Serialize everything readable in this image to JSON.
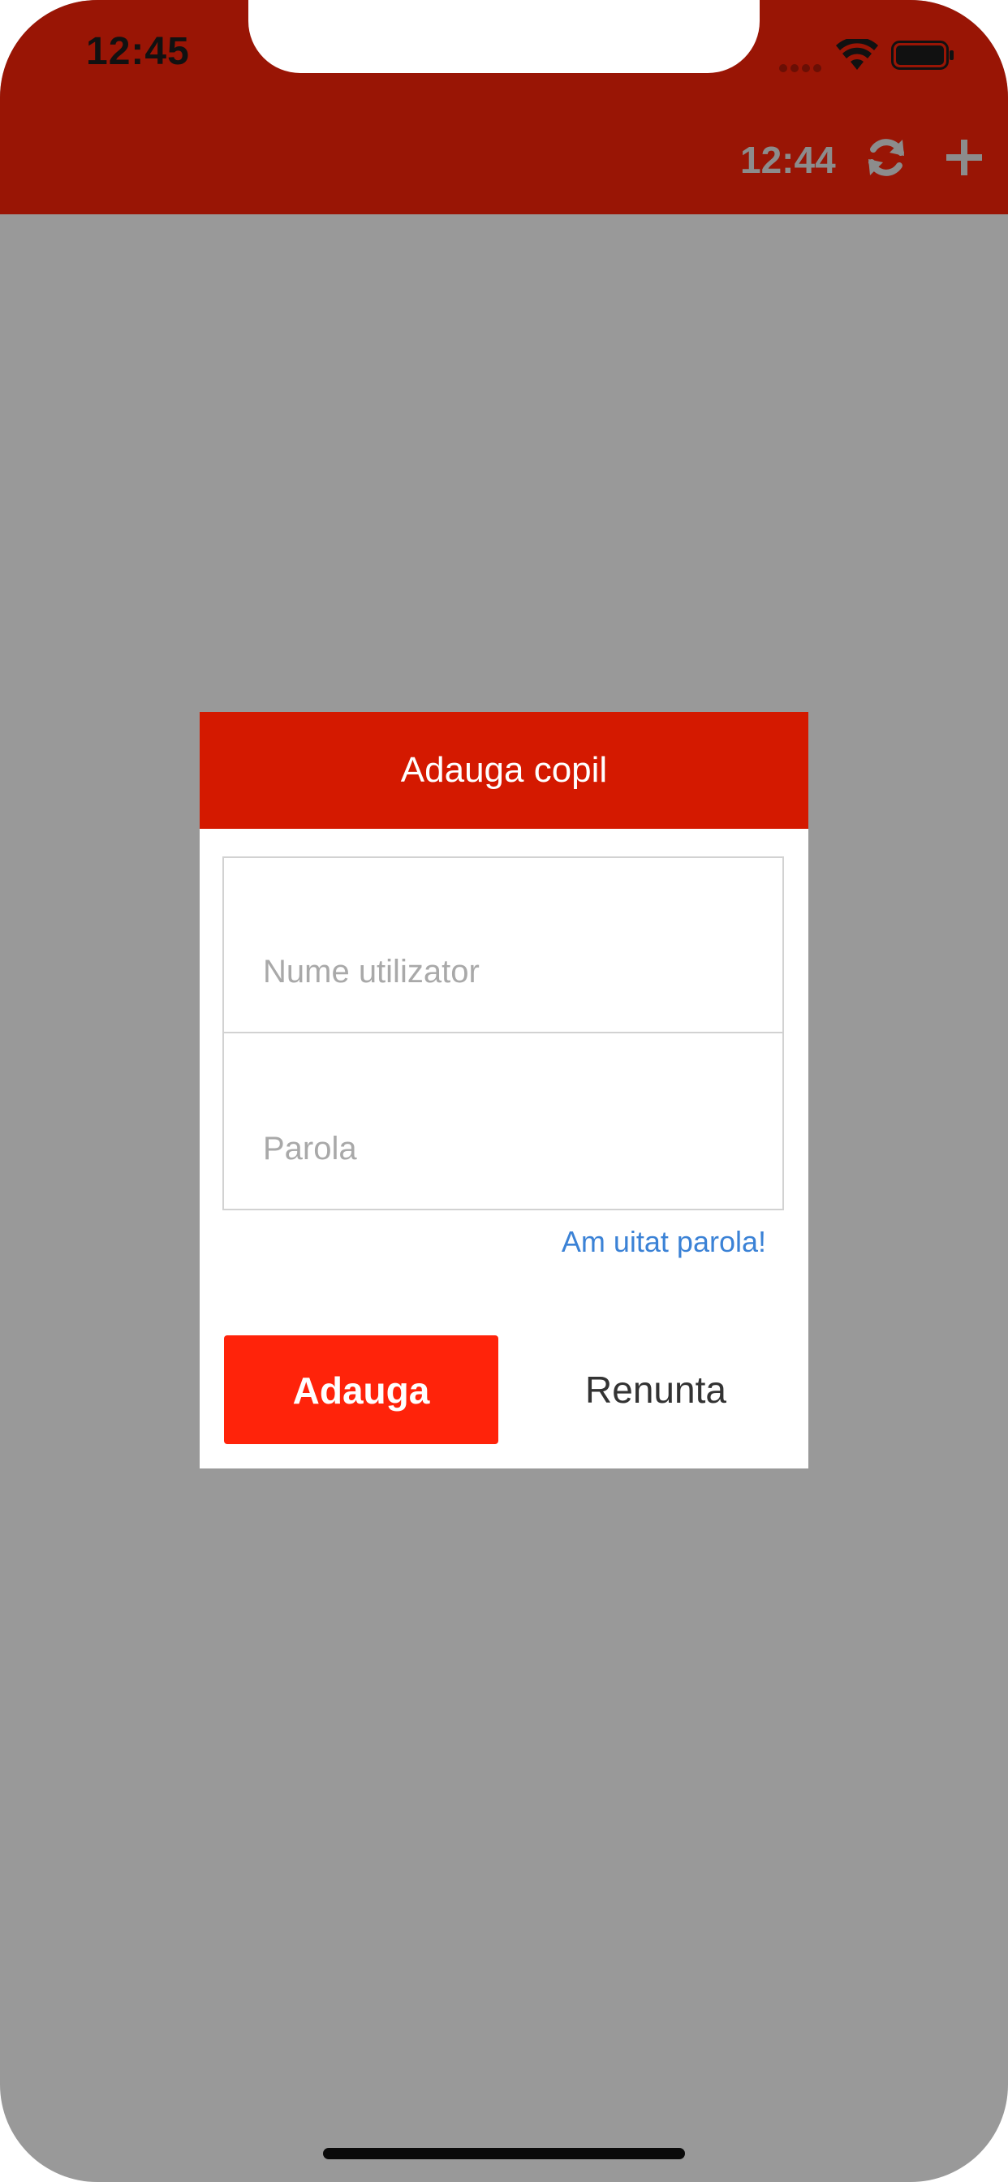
{
  "status_bar": {
    "time": "12:45"
  },
  "nav_bar": {
    "time": "12:44",
    "refresh_icon": "refresh-icon",
    "add_icon": "plus-icon"
  },
  "dialog": {
    "title": "Adauga copil",
    "username_placeholder": "Nume utilizator",
    "username_value": "",
    "password_placeholder": "Parola",
    "password_value": "",
    "forgot_password_label": "Am uitat parola!",
    "add_button_label": "Adauga",
    "cancel_button_label": "Renunta"
  },
  "colors": {
    "header_dimmed": "#991505",
    "dialog_header": "#d41900",
    "primary_button": "#ff230a",
    "link": "#3b82d6",
    "overlay": "#999999"
  }
}
